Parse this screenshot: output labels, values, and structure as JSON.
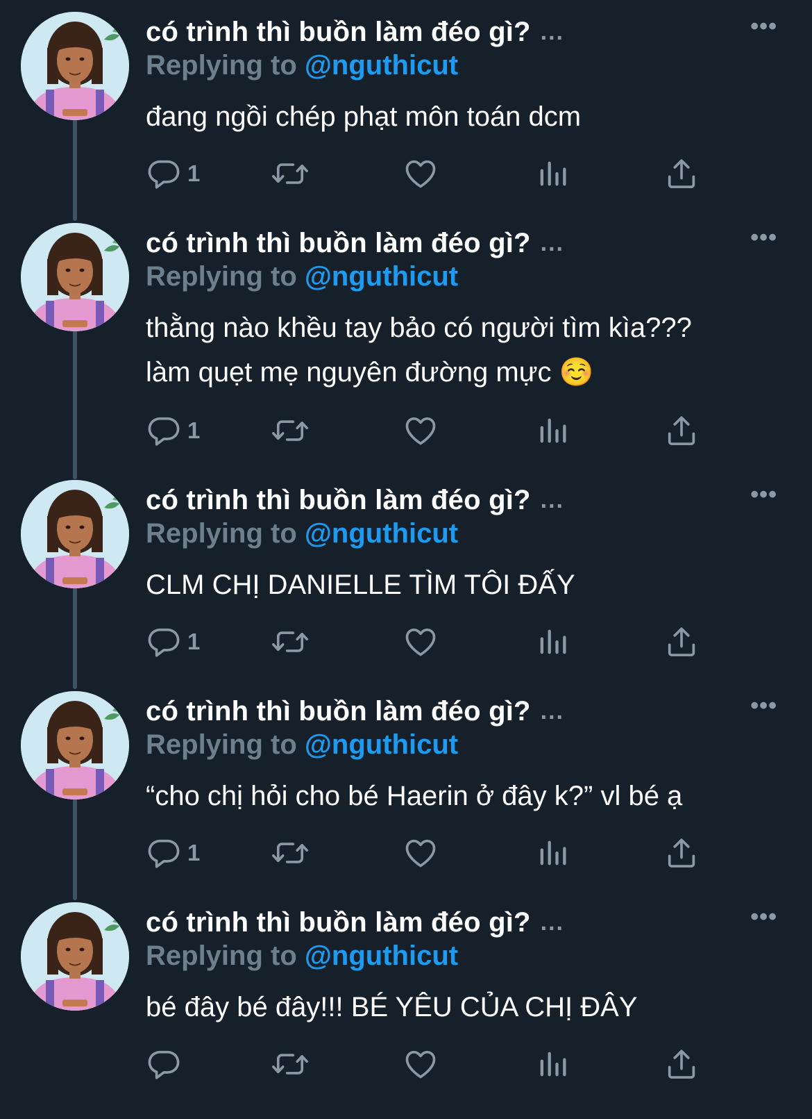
{
  "thread": {
    "tweets": [
      {
        "display_name": "có trình thì buồn làm đéo gì?",
        "name_ellipsis": "...",
        "more_label": "•••",
        "replying_prefix": "Replying to",
        "replying_handle": "@nguthicut",
        "text": "đang ngồi chép phạt môn toán dcm",
        "reply_count": "1"
      },
      {
        "display_name": "có trình thì buồn làm đéo gì?",
        "name_ellipsis": "...",
        "more_label": "•••",
        "replying_prefix": "Replying to",
        "replying_handle": "@nguthicut",
        "text": "thằng nào khều tay bảo có người tìm kìa???\nlàm quẹt mẹ nguyên đường mực ☺️",
        "reply_count": "1"
      },
      {
        "display_name": "có trình thì buồn làm đéo gì?",
        "name_ellipsis": "...",
        "more_label": "•••",
        "replying_prefix": "Replying to",
        "replying_handle": "@nguthicut",
        "text": "CLM CHỊ DANIELLE TÌM TÔI ĐẤY",
        "reply_count": "1"
      },
      {
        "display_name": "có trình thì buồn làm đéo gì?",
        "name_ellipsis": "...",
        "more_label": "•••",
        "replying_prefix": "Replying to",
        "replying_handle": "@nguthicut",
        "text": "“cho chị hỏi cho bé Haerin ở đây k?” vl bé ạ",
        "reply_count": "1"
      },
      {
        "display_name": "có trình thì buồn làm đéo gì?",
        "name_ellipsis": "...",
        "more_label": "•••",
        "replying_prefix": "Replying to",
        "replying_handle": "@nguthicut",
        "text": "bé đây bé đây!!! BÉ YÊU CỦA CHỊ ĐÂY",
        "reply_count": ""
      }
    ]
  },
  "icons": {
    "reply": "reply-icon",
    "retweet": "retweet-icon",
    "like": "heart-icon",
    "views": "analytics-icon",
    "share": "share-icon"
  },
  "colors": {
    "background": "#15202b",
    "text": "#ffffff",
    "muted": "#8b98a5",
    "handle": "#1d9bf0",
    "thread_line": "#3d5466"
  }
}
